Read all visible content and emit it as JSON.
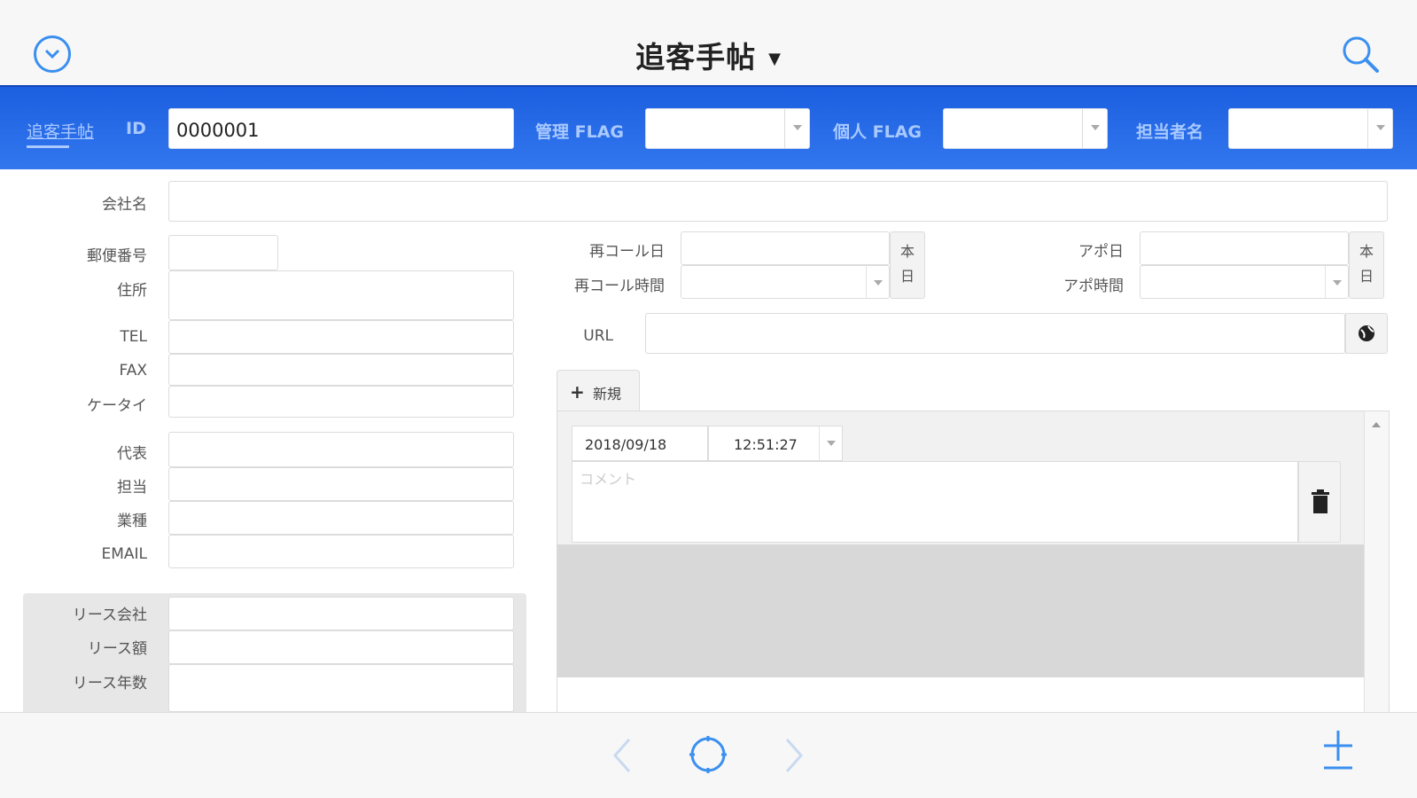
{
  "app": {
    "title": "追客手帖"
  },
  "colors": {
    "accent": "#3a8ff0",
    "header_blue": "#2a6ce8"
  },
  "header": {
    "tab_label": "追客手帖",
    "id_label": "ID",
    "id_value": "0000001",
    "kanri_flag_label": "管理 FLAG",
    "kojin_flag_label": "個人 FLAG",
    "tantousha_label": "担当者名"
  },
  "form": {
    "company_label": "会社名",
    "zip_label": "郵便番号",
    "address_label": "住所",
    "tel_label": "TEL",
    "fax_label": "FAX",
    "mobile_label": "ケータイ",
    "rep_label": "代表",
    "person_label": "担当",
    "industry_label": "業種",
    "email_label": "EMAIL",
    "lease_company_label": "リース会社",
    "lease_amount_label": "リース額",
    "lease_years_label": "リース年数",
    "recall_date_label": "再コール日",
    "recall_time_label": "再コール時間",
    "appo_date_label": "アポ日",
    "appo_time_label": "アポ時間",
    "today_button": [
      "本",
      "日"
    ],
    "url_label": "URL"
  },
  "log": {
    "new_tab_label": "新規",
    "entry_date": "2018/09/18",
    "entry_time": "12:51:27",
    "comment_placeholder": "コメント"
  },
  "icons": {
    "menu": "chevron-down-circle-icon",
    "search": "search-icon",
    "globe": "globe-icon",
    "trash": "trash-icon",
    "prev": "chevron-left-icon",
    "refresh": "circle-icon",
    "next": "chevron-right-icon",
    "add": "plus-icon"
  }
}
